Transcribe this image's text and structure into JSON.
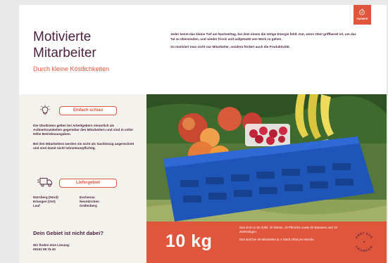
{
  "header": {
    "title_line1": "Motivierte",
    "title_line2": "Mitarbeiter",
    "subtitle": "Durch kleine Köstlichkeiten",
    "intro_p1": "Jeder kennt das kleine Tief am Nachmittag, bei dem einem die nötige Energie fehlt. Gut, wenn Obst griffbereit ist, um das Tal zu überwinden, und wieder frisch und aufgetankt ans Werk zu gehen.",
    "intro_p2": "So motiviert man nicht nur Mitarbeiter, sondern fördert auch die Produktivität.",
    "logo_word": "FARMER",
    "logo_icon": "fruit-logo-icon"
  },
  "colors": {
    "accent": "#e0563d",
    "text": "#4a1f3d",
    "panel": "#f3f2ec"
  },
  "left": {
    "section1": {
      "icon": "lightbulb-icon",
      "pill": "Einfach schlau",
      "p1": "Die Obstkisten gelten bei Arbeitgebern steuerlich als Aufmerksamkeiten gegenüber den Mitarbeitern und sind in voller Höhe Betriebsausgaben.",
      "p2": "Bei den Mitarbeitern werden sie nicht als Sachbezug angerechnet und sind damit nicht lohnsteuerpflichtig."
    },
    "section2": {
      "icon": "delivery-truck-icon",
      "pill": "Liefergebiet",
      "col1": [
        "Nürnberg (Nord)",
        "Erlangen (Ost)",
        "Lauf"
      ],
      "col2": [
        "Eschenau",
        "Neunkirchen",
        "Gräfenberg"
      ]
    },
    "cta": {
      "heading": "Dein Gebiet ist nicht dabei?",
      "line1": "Wir finden eine Lösung:",
      "phone": "09192 99 76 40"
    }
  },
  "banner": {
    "big": "10 kg",
    "p1": "Das sind ca 30 Äpfel, 10 Birnen, 10 Pfirsiche sowie 20 Bananen und 10 Zwetschgen.",
    "p2": "Das sind bei 40 Mitarbeiter je 2 Stück Obst pro Woche.",
    "stamp_top": "OBST AUS",
    "stamp_bottom": "FRANKEN"
  }
}
